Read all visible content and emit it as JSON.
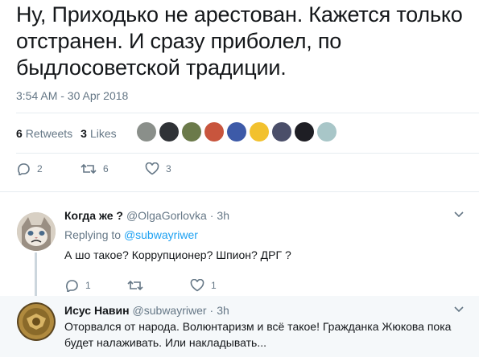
{
  "tweet": {
    "text": "Ну, Приходько не арестован. Кажется только отстранен. И сразу приболел, по быдлосоветской традиции.",
    "timestamp": "3:54 AM - 30 Apr 2018",
    "retweets_count": "6",
    "retweets_label": "Retweets",
    "likes_count": "3",
    "likes_label": "Likes",
    "actions": {
      "replies": "2",
      "retweets": "6",
      "likes": "3"
    }
  },
  "liker_avatars": [
    "#8a8f8a",
    "#2f3236",
    "#6b7a4a",
    "#c8553d",
    "#3d5aa8",
    "#f2c12e",
    "#4a4e69",
    "#1e1e24",
    "#a8c6c8"
  ],
  "replies": [
    {
      "fullname": "Когда же ?",
      "handle": "@OlgaGorlovka",
      "time": "3h",
      "replying_prefix": "Replying to",
      "replying_to": "@subwayriwer",
      "text": "А шо такое? Коррупционер? Шпион? ДРГ ?",
      "actions": {
        "replies": "1",
        "retweets": "",
        "likes": "1"
      }
    },
    {
      "fullname": "Исус Навин",
      "handle": "@subwayriwer",
      "time": "3h",
      "text": "Оторвался от народа. Волюнтаризм и всё такое! Гражданка Жюкова пока будет налаживать. Или накладывать..."
    }
  ],
  "colors": {
    "accent": "#1da1f2",
    "muted": "#657786",
    "text": "#14171a",
    "border": "#e6ecf0"
  }
}
